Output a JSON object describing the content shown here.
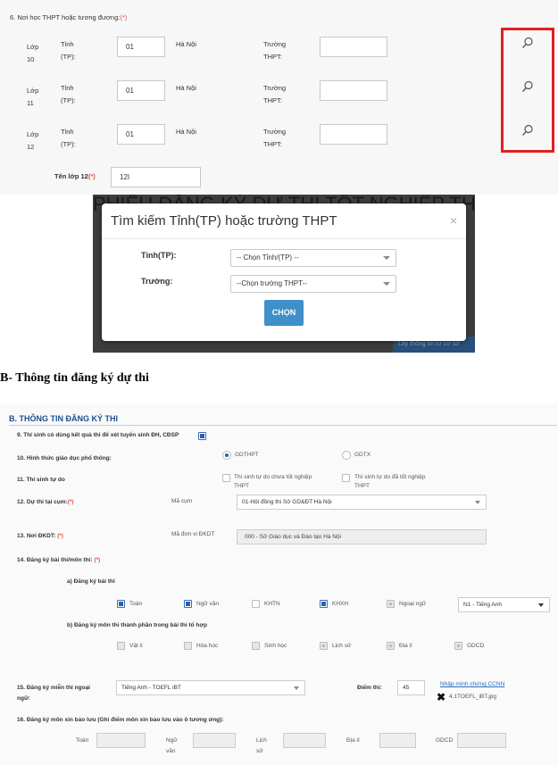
{
  "top": {
    "section_label": "6. Nơi học THPT hoặc tương đương:",
    "required_mark": "(*)",
    "rows": [
      {
        "lop": "Lớp",
        "num": "10",
        "tinh": "Tỉnh",
        "tp": "(TP):",
        "code": "01",
        "city": "Hà Nội",
        "truong": "Trường",
        "thpt": "THPT:",
        "school": ""
      },
      {
        "lop": "Lớp",
        "num": "11",
        "tinh": "Tỉnh",
        "tp": "(TP):",
        "code": "01",
        "city": "Hà Nội",
        "truong": "Trường",
        "thpt": "THPT:",
        "school": ""
      },
      {
        "lop": "Lớp",
        "num": "12",
        "tinh": "Tỉnh",
        "tp": "(TP):",
        "code": "01",
        "city": "Hà Nội",
        "truong": "Trường",
        "thpt": "THPT:",
        "school": ""
      }
    ],
    "class_name_label": "Tên lớp 12",
    "class_name_value": "12I"
  },
  "modal": {
    "background_text": "PHIẾU ĐĂNG KÝ DỰ THI TỐT NGHIỆP THPT",
    "background_bottom": "Lấy thông tin từ cơ sở",
    "title": "Tìm kiếm Tỉnh(TP) hoặc trường THPT",
    "close": "×",
    "province_label": "Tỉnh(TP):",
    "province_value": "-- Chọn Tỉnh/(TP) --",
    "school_label": "Trường:",
    "school_value": "--Chọn trường THPT--",
    "choose_button": "CHỌN"
  },
  "section_b_heading": "B- Thông tin đăng ký dự thi",
  "form": {
    "title": "B. THÔNG TIN ĐĂNG KÝ THI",
    "q9": "9. Thí sinh có dùng kết quả thi để xét tuyển sinh ĐH, CĐSP",
    "q10": "10. Hình thức giáo dục phổ thông:",
    "q10_opt1": "GDTHPT",
    "q10_opt2": "GDTX",
    "q11": "11. Thí sinh tự do",
    "q11_opt1a": "Thí sinh tự do chưa tốt nghiệp",
    "q11_opt1b": "THPT",
    "q11_opt2a": "Thí sinh tự do đã tốt nghiệp",
    "q11_opt2b": "THPT",
    "q12": "12. Dự thi tại cụm:",
    "q12_code_label": "Mã cụm",
    "q12_value": "01-Hội đồng thi Sở GD&ĐT Hà Nội",
    "q13": "13. Nơi ĐKDT:",
    "q13_code_label": "Mã đơn vị ĐKDT",
    "q13_value": "000 - Sở Giáo dục và Đào tạo Hà Nội",
    "q14": "14. Đăng ký bài thi/môn thi:",
    "q14a": "a) Đăng ký bài thi",
    "q14a_options": [
      "Toán",
      "Ngữ văn",
      "KHTN",
      "KHXH",
      "Ngoại ngữ"
    ],
    "language_value": "N1 - Tiếng Anh",
    "q14b": "b) Đăng ký môn thi thành phần trong bài thi tổ hợp",
    "q14b_options": [
      "Vật lí",
      "Hóa học",
      "Sinh học",
      "Lịch sử",
      "Địa lí",
      "GDCD"
    ],
    "q15a": "15. Đăng ký miễn thi ngoại",
    "q15b": "ngữ:",
    "q15_value": "Tiếng Anh - TOEFL iBT",
    "score_label": "Điểm thi:",
    "score_value": "45",
    "cert_link": "Nhập minh chứng CCNN",
    "cert_file": "4.1TOEFL_iBT.jpg",
    "q16": "16. Đăng ký môn xin bảo lưu (Ghi điểm môn xin bảo lưu vào ô tương ứng):",
    "q16_labels": [
      "Toán",
      "Ngữ",
      "văn",
      "Lịch",
      "sử",
      "Địa lí",
      "GDCD"
    ]
  }
}
